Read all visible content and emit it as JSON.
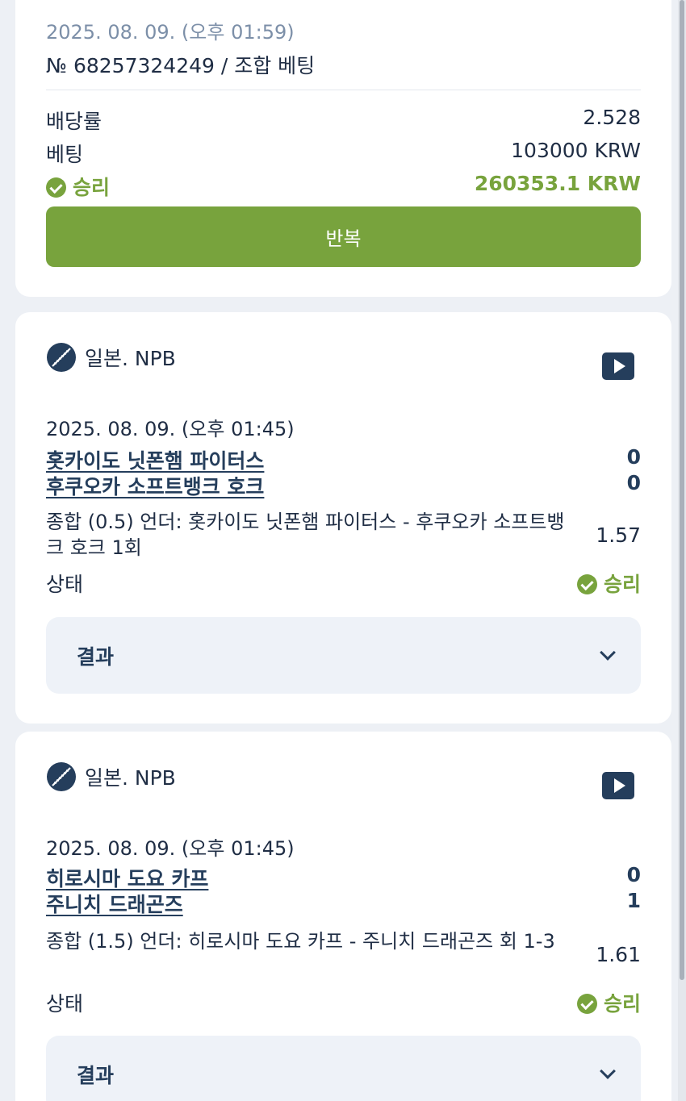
{
  "summary": {
    "date": "2025. 08. 09. (오후 01:59)",
    "bet_id": "№ 68257324249 / 조합 베팅",
    "odds_label": "배당률",
    "odds_value": "2.528",
    "stake_label": "베팅",
    "stake_value": "103000 KRW",
    "status_label": "승리",
    "payout_value": "260353.1 KRW",
    "repeat_button": "반복"
  },
  "events": [
    {
      "league": "일본. NPB",
      "date": "2025. 08. 09. (오후 01:45)",
      "team1": "홋카이도 닛폰햄 파이터스",
      "team2": "후쿠오카 소프트뱅크 호크",
      "score1": "0",
      "score2": "0",
      "market": "종합 (0.5) 언더: 홋카이도 닛폰햄 파이터스 - 후쿠오카 소프트뱅크 호크 1회",
      "market_odds": "1.57",
      "status_label": "상태",
      "status_value": "승리",
      "result_label": "결과"
    },
    {
      "league": "일본. NPB",
      "date": "2025. 08. 09. (오후 01:45)",
      "team1": "히로시마 도요 카프",
      "team2": "주니치 드래곤즈",
      "score1": "0",
      "score2": "1",
      "market": "종합 (1.5) 언더: 히로시마 도요 카프 - 주니치 드래곤즈 회 1-3",
      "market_odds": "1.61",
      "status_label": "상태",
      "status_value": "승리",
      "result_label": "결과"
    }
  ],
  "colors": {
    "win": "#78a33d",
    "navy": "#253e5c",
    "background": "#edf0f5"
  },
  "icons": {
    "sport": "baseball-icon",
    "video": "video-play-icon",
    "status": "check-circle-icon",
    "expand": "chevron-down-icon"
  }
}
